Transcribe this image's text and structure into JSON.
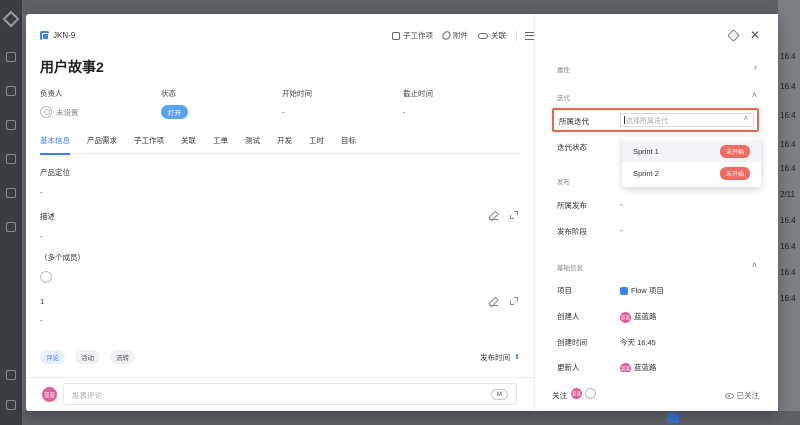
{
  "background": {
    "right_values": [
      "16:4",
      "16:4",
      "16:4",
      "16:4",
      "16:4",
      "2/11",
      "16:4",
      "16:4",
      "16:4",
      "16:4"
    ]
  },
  "issue": {
    "key": "JKN-9",
    "title": "用户故事2",
    "actions": {
      "subtask": "子工作项",
      "attachment": "附件",
      "link": "关联"
    },
    "props": {
      "assignee_label": "负责人",
      "assignee_value": "未设置",
      "status_label": "状态",
      "status_value": "打开",
      "start_label": "开始时间",
      "start_value": "-",
      "end_label": "截止时间",
      "end_value": "-"
    },
    "tabs": [
      "基本信息",
      "产品需求",
      "子工作项",
      "关联",
      "工单",
      "测试",
      "开发",
      "工时",
      "目标"
    ],
    "fields": {
      "positioning_label": "产品定位",
      "positioning_value": "-",
      "description_label": "描述",
      "description_value": "-",
      "members_label": "（多个成员）",
      "one_label": "1",
      "one_value": "-"
    },
    "activity": {
      "chips": [
        "评论",
        "活动",
        "流转"
      ],
      "release_time": "发布时间",
      "sort_icon": "sort-asc-icon"
    },
    "comment": {
      "avatar_text": "蓝蓝",
      "placeholder": "发表评论",
      "mention_badge": "M"
    }
  },
  "side": {
    "attributes_header": "属性",
    "iteration_header": "迭代",
    "iteration_label": "所属迭代",
    "iteration_placeholder": "选择所属迭代",
    "iteration_status_label": "迭代状态",
    "release_header": "发布",
    "release_label": "所属发布",
    "release_value": "-",
    "release_stage_label": "发布阶段",
    "release_stage_value": "-",
    "basic_header": "基础信息",
    "project_label": "项目",
    "project_value": "Flow 项目",
    "creator_label": "创建人",
    "creator_value": "蓝蓝路",
    "created_time_label": "创建时间",
    "created_time_value": "今天 16:45",
    "updater_label": "更新人",
    "updater_value": "蓝蓝路",
    "avatar_text": "蓝蓝",
    "follow_label": "关注",
    "followed_label": "已关注",
    "dropdown": [
      {
        "name": "Sprint 1",
        "badge": "未开始"
      },
      {
        "name": "Sprint 2",
        "badge": "未开始"
      }
    ]
  },
  "colors": {
    "accent": "#3b82f6",
    "highlight_border": "#e4694e",
    "badge_red": "#ef6b61",
    "avatar_pink": "#e05c9a"
  }
}
